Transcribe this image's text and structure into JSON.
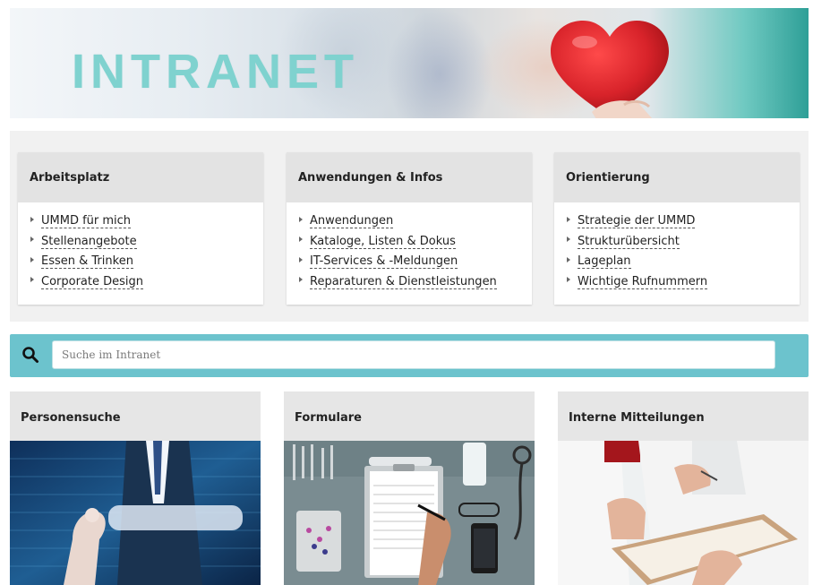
{
  "banner": {
    "title": "INTRANET",
    "heart_icon": "heart-icon"
  },
  "link_boxes": [
    {
      "title": "Arbeitsplatz",
      "items": [
        "UMMD für mich",
        "Stellenangebote",
        "Essen & Trinken",
        "Corporate Design"
      ]
    },
    {
      "title": "Anwendungen & Infos",
      "items": [
        "Anwendungen",
        "Kataloge, Listen & Dokus",
        "IT-Services & -Meldungen",
        "Reparaturen & Dienstleistungen"
      ]
    },
    {
      "title": "Orientierung",
      "items": [
        "Strategie der UMMD",
        "Strukturübersicht",
        "Lageplan",
        "Wichtige Rufnummern"
      ]
    }
  ],
  "search": {
    "placeholder": "Suche im Intranet",
    "icon": "search-icon",
    "bar_color": "#6cc3cd"
  },
  "tiles": [
    {
      "title": "Personensuche"
    },
    {
      "title": "Formulare"
    },
    {
      "title": "Interne Mitteilungen"
    }
  ],
  "colors": {
    "accent": "#6cc3cd",
    "banner_text": "#7fd2cf",
    "heart": "#d8232a"
  }
}
